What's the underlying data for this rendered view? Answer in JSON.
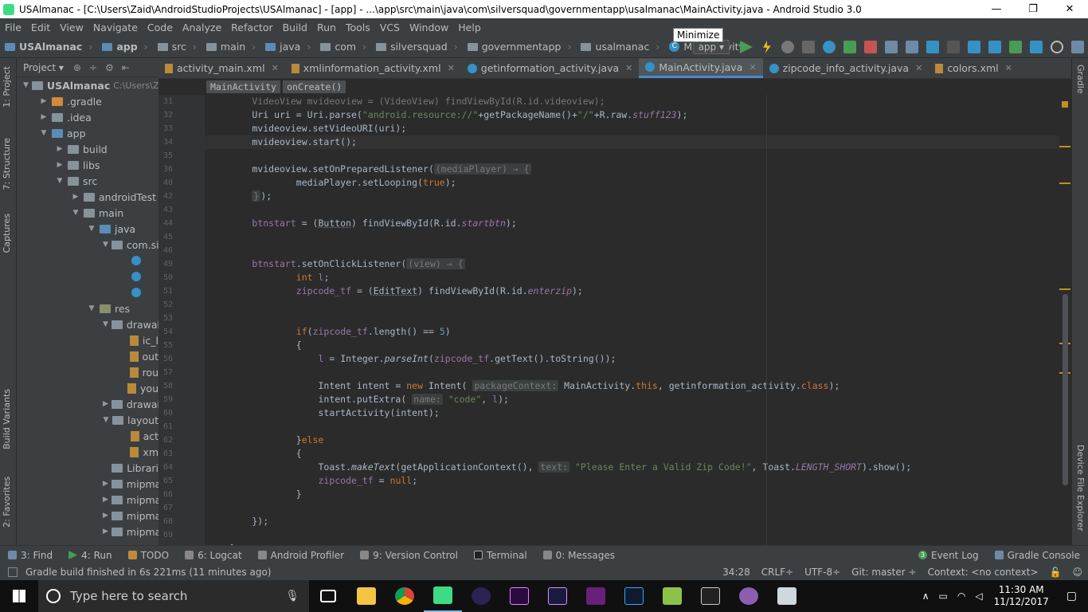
{
  "window": {
    "title": "USAlmanac - [C:\\Users\\Zaid\\AndroidStudioProjects\\USAlmanac] - [app] - ...\\app\\src\\main\\java\\com\\silversquad\\governmentapp\\usalmanac\\MainActivity.java - Android Studio 3.0",
    "minimize_tooltip": "Minimize",
    "ctl_min": "—",
    "ctl_max": "❐",
    "ctl_close": "✕"
  },
  "menu": [
    "File",
    "Edit",
    "View",
    "Navigate",
    "Code",
    "Analyze",
    "Refactor",
    "Build",
    "Run",
    "Tools",
    "VCS",
    "Window",
    "Help"
  ],
  "navbar": {
    "crumbs": [
      "USAlmanac",
      "app",
      "src",
      "main",
      "java",
      "com",
      "silversquad",
      "governmentapp",
      "usalmanac",
      "MainActivity"
    ],
    "run_config": "app ▾"
  },
  "left_tool_tabs": [
    "1: Project",
    "7: Structure",
    "Captures",
    "Build Variants",
    "2: Favorites"
  ],
  "right_tool_tabs": [
    "Gradle",
    "Device File Explorer"
  ],
  "project_panel": {
    "header": "Project ▾",
    "tree": [
      {
        "label": "USAlmanac",
        "suffix": "C:\\Users\\Zai",
        "depth": 0,
        "arrow": "▼",
        "icon": "folder"
      },
      {
        "label": ".gradle",
        "depth": 1,
        "arrow": "▶",
        "icon": "orange"
      },
      {
        "label": ".idea",
        "depth": 1,
        "arrow": "▶",
        "icon": "folder"
      },
      {
        "label": "app",
        "depth": 1,
        "arrow": "▼",
        "icon": "blue"
      },
      {
        "label": "build",
        "depth": 2,
        "arrow": "▶",
        "icon": "folder"
      },
      {
        "label": "libs",
        "depth": 2,
        "arrow": "▶",
        "icon": "folder"
      },
      {
        "label": "src",
        "depth": 2,
        "arrow": "▼",
        "icon": "folder"
      },
      {
        "label": "androidTest",
        "depth": 3,
        "arrow": "▶",
        "icon": "folder"
      },
      {
        "label": "main",
        "depth": 3,
        "arrow": "▼",
        "icon": "folder"
      },
      {
        "label": "java",
        "depth": 4,
        "arrow": "▼",
        "icon": "blue"
      },
      {
        "label": "com.si",
        "depth": 5,
        "arrow": "▼",
        "icon": "folder"
      },
      {
        "label": "",
        "depth": 6,
        "arrow": "",
        "icon": "class"
      },
      {
        "label": "",
        "depth": 6,
        "arrow": "",
        "icon": "class"
      },
      {
        "label": "",
        "depth": 6,
        "arrow": "",
        "icon": "class"
      },
      {
        "label": "res",
        "depth": 4,
        "arrow": "▼",
        "icon": "res"
      },
      {
        "label": "drawab",
        "depth": 5,
        "arrow": "▼",
        "icon": "folder"
      },
      {
        "label": "ic_l",
        "depth": 6,
        "arrow": "",
        "icon": "xml"
      },
      {
        "label": "out",
        "depth": 6,
        "arrow": "",
        "icon": "xml"
      },
      {
        "label": "rou",
        "depth": 6,
        "arrow": "",
        "icon": "xml"
      },
      {
        "label": "you",
        "depth": 6,
        "arrow": "",
        "icon": "xml"
      },
      {
        "label": "drawab",
        "depth": 5,
        "arrow": "▶",
        "icon": "folder"
      },
      {
        "label": "layout",
        "depth": 5,
        "arrow": "▼",
        "icon": "folder"
      },
      {
        "label": "act",
        "depth": 6,
        "arrow": "",
        "icon": "xml"
      },
      {
        "label": "xm",
        "depth": 6,
        "arrow": "",
        "icon": "xml"
      },
      {
        "label": "Librari",
        "depth": 5,
        "arrow": "",
        "icon": "folder"
      },
      {
        "label": "mipma",
        "depth": 5,
        "arrow": "▶",
        "icon": "folder"
      },
      {
        "label": "mipma",
        "depth": 5,
        "arrow": "▶",
        "icon": "folder"
      },
      {
        "label": "mipma",
        "depth": 5,
        "arrow": "▶",
        "icon": "folder"
      },
      {
        "label": "mipma",
        "depth": 5,
        "arrow": "▶",
        "icon": "folder"
      }
    ]
  },
  "tabs": [
    {
      "label": "activity_main.xml",
      "type": "xml",
      "active": false
    },
    {
      "label": "xmlinformation_activity.xml",
      "type": "xml",
      "active": false
    },
    {
      "label": "getinformation_activity.java",
      "type": "java",
      "active": false
    },
    {
      "label": "MainActivity.java",
      "type": "java",
      "active": true
    },
    {
      "label": "zipcode_info_activity.java",
      "type": "java",
      "active": false
    },
    {
      "label": "colors.xml",
      "type": "xml",
      "active": false
    }
  ],
  "breadcrumb": [
    "MainActivity",
    "onCreate()"
  ],
  "line_numbers": [
    "31",
    "32",
    "33",
    "34",
    "35",
    "36",
    "40",
    "42",
    "43",
    "44",
    "45",
    "46",
    "49",
    "50",
    "51",
    "52",
    "53",
    "54",
    "55",
    "56",
    "57",
    "58",
    "59",
    "60",
    "61",
    "62",
    "63",
    "64",
    "65",
    "66",
    "67",
    "68",
    "69"
  ],
  "bottom_tools": [
    "3: Find",
    "4: Run",
    "TODO",
    "6: Logcat",
    "Android Profiler",
    "9: Version Control",
    "Terminal",
    "0: Messages",
    "Event Log",
    "Gradle Console"
  ],
  "event_log_count": "3",
  "status": {
    "message": "Gradle build finished in 6s 221ms (11 minutes ago)",
    "position": "34:28",
    "line_sep": "CRLF÷",
    "encoding": "UTF-8÷",
    "git": "Git: master ÷",
    "context": "Context: <no context>"
  },
  "taskbar": {
    "search_placeholder": "Type here to search",
    "time": "11:30 AM",
    "date": "11/12/2017"
  },
  "colors": {
    "accent": "#4a88c7",
    "editor_bg": "#2b2b2b",
    "panel_bg": "#3c3f41",
    "keyword": "#cc7832",
    "string": "#6a8759",
    "number": "#6897bb",
    "field": "#9876aa"
  }
}
